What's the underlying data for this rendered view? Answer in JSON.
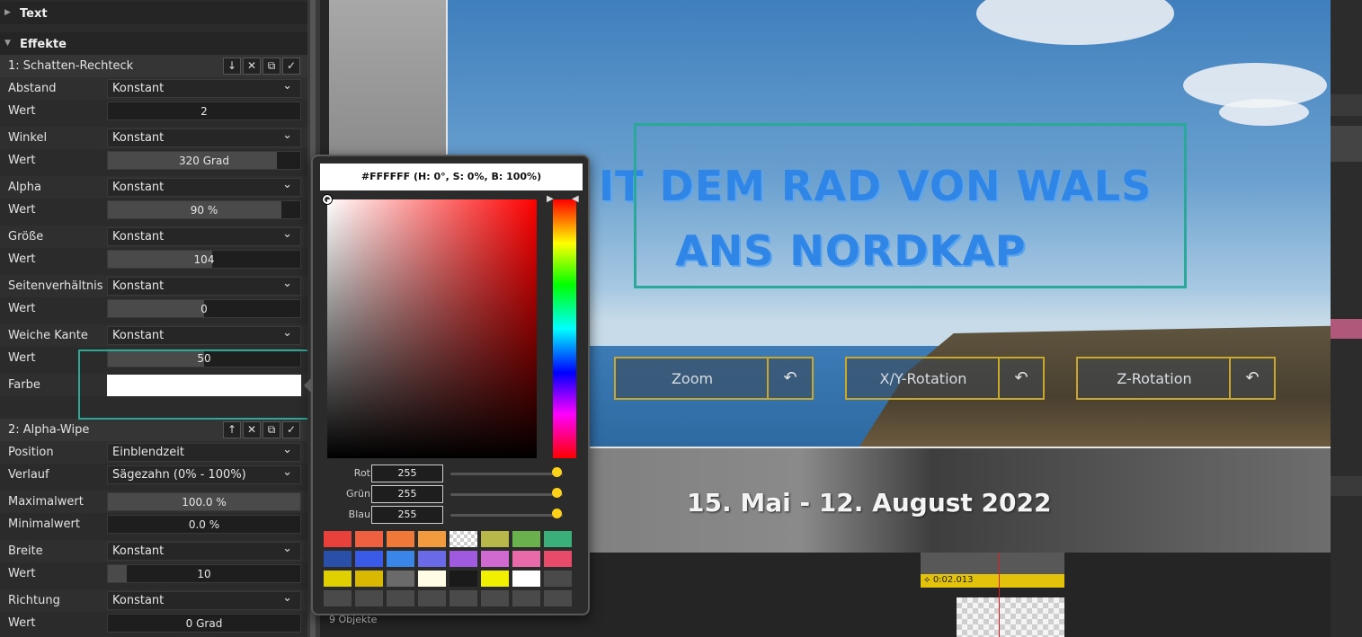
{
  "panel": {
    "text_section": "Text",
    "effects_section": "Effekte",
    "effect1": {
      "title": "1: Schatten-Rechteck"
    },
    "effect2": {
      "title": "2: Alpha-Wipe"
    },
    "rows1": [
      {
        "label": "Abstand",
        "value": "Konstant",
        "kind": "dropdown"
      },
      {
        "label": "Wert",
        "value": "2",
        "kind": "num",
        "fill": 0
      },
      {
        "label": "Winkel",
        "value": "Konstant",
        "kind": "dropdown"
      },
      {
        "label": "Wert",
        "value": "320 Grad",
        "kind": "num",
        "fill": 0.88
      },
      {
        "label": "Alpha",
        "value": "Konstant",
        "kind": "dropdown"
      },
      {
        "label": "Wert",
        "value": "90 %",
        "kind": "num",
        "fill": 0.9
      },
      {
        "label": "Größe",
        "value": "Konstant",
        "kind": "dropdown"
      },
      {
        "label": "Wert",
        "value": "104",
        "kind": "num",
        "fill": 0.54
      },
      {
        "label": "Seitenverhältnis",
        "value": "Konstant",
        "kind": "dropdown"
      },
      {
        "label": "Wert",
        "value": "0",
        "kind": "num",
        "fill": 0.5
      },
      {
        "label": "Weiche Kante",
        "value": "Konstant",
        "kind": "dropdown"
      },
      {
        "label": "Wert",
        "value": "50",
        "kind": "num",
        "fill": 0.5
      },
      {
        "label": "Farbe",
        "value": "",
        "kind": "color"
      }
    ],
    "rows2": [
      {
        "label": "Position",
        "value": "Einblendzeit",
        "kind": "dropdown"
      },
      {
        "label": "Verlauf",
        "value": "Sägezahn (0% - 100%)",
        "kind": "dropdown"
      },
      {
        "label": "Maximalwert",
        "value": "100.0 %",
        "kind": "num",
        "fill": 1
      },
      {
        "label": "Minimalwert",
        "value": "0.0 %",
        "kind": "num",
        "fill": 0
      },
      {
        "label": "Breite",
        "value": "Konstant",
        "kind": "dropdown"
      },
      {
        "label": "Wert",
        "value": "10",
        "kind": "num",
        "fill": 0.1
      },
      {
        "label": "Richtung",
        "value": "Konstant",
        "kind": "dropdown"
      },
      {
        "label": "Wert",
        "value": "0 Grad",
        "kind": "num",
        "fill": 0
      }
    ]
  },
  "preview": {
    "title_line1": "IT DEM RAD VON WALS",
    "title_line2": "ANS NORDKAP",
    "date": "15. Mai - 12. August 2022",
    "buttons": [
      "Zoom",
      "X/Y-Rotation",
      "Z-Rotation"
    ]
  },
  "picker": {
    "hex": "#FFFFFF (H: 0°, S: 0%, B: 100%)",
    "rgb": [
      {
        "label": "Rot",
        "value": "255"
      },
      {
        "label": "Grün",
        "value": "255"
      },
      {
        "label": "Blau",
        "value": "255"
      }
    ],
    "swatches": [
      "#e8403a",
      "#ef6040",
      "#f07838",
      "#f19a3e",
      "checker",
      "#b8b84a",
      "#6ab04c",
      "#3aaf7a",
      "#2a4fa8",
      "#3a5ae8",
      "#3a86e8",
      "#6a6ae8",
      "#a05ae0",
      "#d06ad0",
      "#e86aa8",
      "#e84a6a",
      "#e0d000",
      "#d8b800",
      "#6a6a6a",
      "#fffce6",
      "#1a1a1a",
      "#f0f000",
      "#ffffff",
      "#4a4a4a",
      "#4a4a4a",
      "#4a4a4a",
      "#4a4a4a",
      "#4a4a4a",
      "#4a4a4a",
      "#4a4a4a",
      "#4a4a4a",
      "#4a4a4a"
    ]
  },
  "timeline": {
    "objects_label": "9 Objekte",
    "clip_time": "0:02.013"
  }
}
